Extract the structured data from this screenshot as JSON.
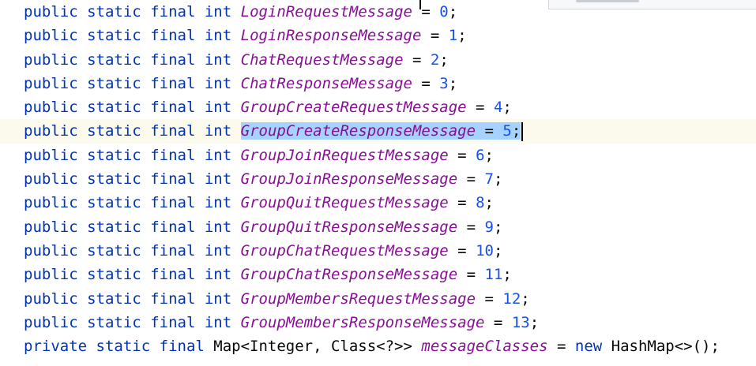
{
  "editor": {
    "keywords": {
      "public": "public",
      "private": "private",
      "static": "static",
      "final": "final",
      "int": "int",
      "new": "new"
    },
    "lines": [
      {
        "field": "LoginRequestMessage",
        "value": "0"
      },
      {
        "field": "LoginResponseMessage",
        "value": "1"
      },
      {
        "field": "ChatRequestMessage",
        "value": "2"
      },
      {
        "field": "ChatResponseMessage",
        "value": "3"
      },
      {
        "field": "GroupCreateRequestMessage",
        "value": "4"
      },
      {
        "field": "GroupCreateResponseMessage",
        "value": "5"
      },
      {
        "field": "GroupJoinRequestMessage",
        "value": "6"
      },
      {
        "field": "GroupJoinResponseMessage",
        "value": "7"
      },
      {
        "field": "GroupQuitRequestMessage",
        "value": "8"
      },
      {
        "field": "GroupQuitResponseMessage",
        "value": "9"
      },
      {
        "field": "GroupChatRequestMessage",
        "value": "10"
      },
      {
        "field": "GroupChatResponseMessage",
        "value": "11"
      },
      {
        "field": "GroupMembersRequestMessage",
        "value": "12"
      },
      {
        "field": "GroupMembersResponseMessage",
        "value": "13"
      }
    ],
    "last_line": {
      "type_decl": "Map<Integer, Class<?>>",
      "field": "messageClasses",
      "init_type": "HashMap<>();"
    },
    "selected_line_index": 5
  },
  "colors": {
    "keyword": "#0033b3",
    "field": "#871094",
    "number": "#1750eb",
    "selection": "#a6d2ff",
    "current_line": "#fcfaed"
  }
}
